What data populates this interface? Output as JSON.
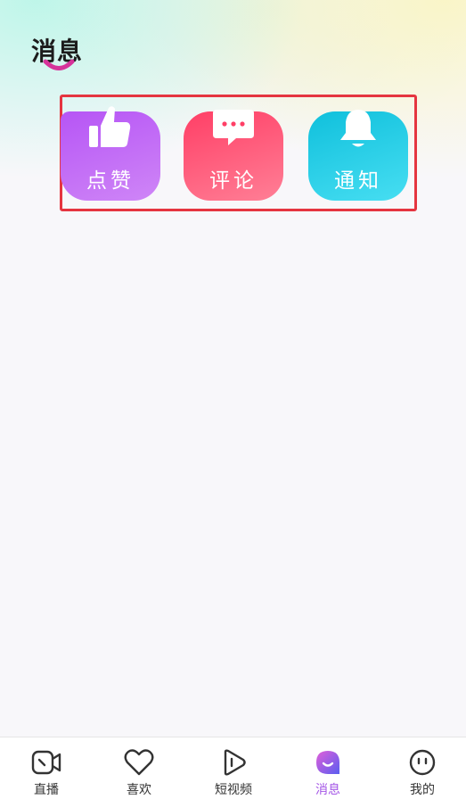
{
  "header": {
    "title": "消息"
  },
  "categories": [
    {
      "label": "点赞",
      "icon": "thumbs-up-icon",
      "color": "#b655f5"
    },
    {
      "label": "评论",
      "icon": "chat-bubble-icon",
      "color": "#ff3f66"
    },
    {
      "label": "通知",
      "icon": "bell-icon",
      "color": "#10c0dc"
    }
  ],
  "tabbar": {
    "items": [
      {
        "label": "直播",
        "icon": "live-icon",
        "active": false
      },
      {
        "label": "喜欢",
        "icon": "heart-icon",
        "active": false
      },
      {
        "label": "短视频",
        "icon": "play-icon",
        "active": false
      },
      {
        "label": "消息",
        "icon": "message-icon",
        "active": true
      },
      {
        "label": "我的",
        "icon": "face-icon",
        "active": false
      }
    ],
    "active_color": "#a355e6"
  },
  "colors": {
    "highlight": "#e53540"
  }
}
